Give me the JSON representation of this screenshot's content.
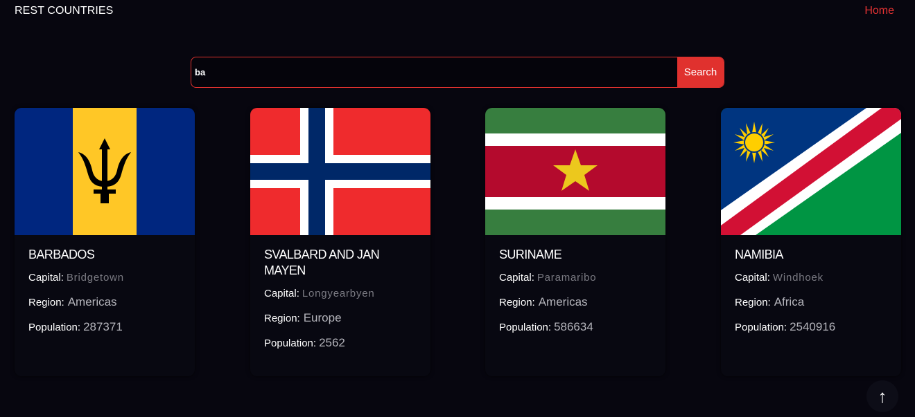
{
  "header": {
    "brand": "REST COUNTRIES",
    "home_label": "Home"
  },
  "search": {
    "value": "ba",
    "button_label": "Search"
  },
  "labels": {
    "capital": "Capital:",
    "region": "Region:",
    "population": "Population:"
  },
  "countries": [
    {
      "name": "BARBADOS",
      "capital": "Bridgetown",
      "region": "Americas",
      "population": "287371",
      "flag": "barbados-flag"
    },
    {
      "name": "SVALBARD AND JAN MAYEN",
      "capital": "Longyearbyen",
      "region": "Europe",
      "population": "2562",
      "flag": "svalbard-flag"
    },
    {
      "name": "SURINAME",
      "capital": "Paramaribo",
      "region": "Americas",
      "population": "586634",
      "flag": "suriname-flag"
    },
    {
      "name": "NAMIBIA",
      "capital": "Windhoek",
      "region": "Africa",
      "population": "2540916",
      "flag": "namibia-flag"
    }
  ],
  "scroll_top_icon": "↑",
  "colors": {
    "accent": "#e0312e",
    "background": "#07060f"
  }
}
